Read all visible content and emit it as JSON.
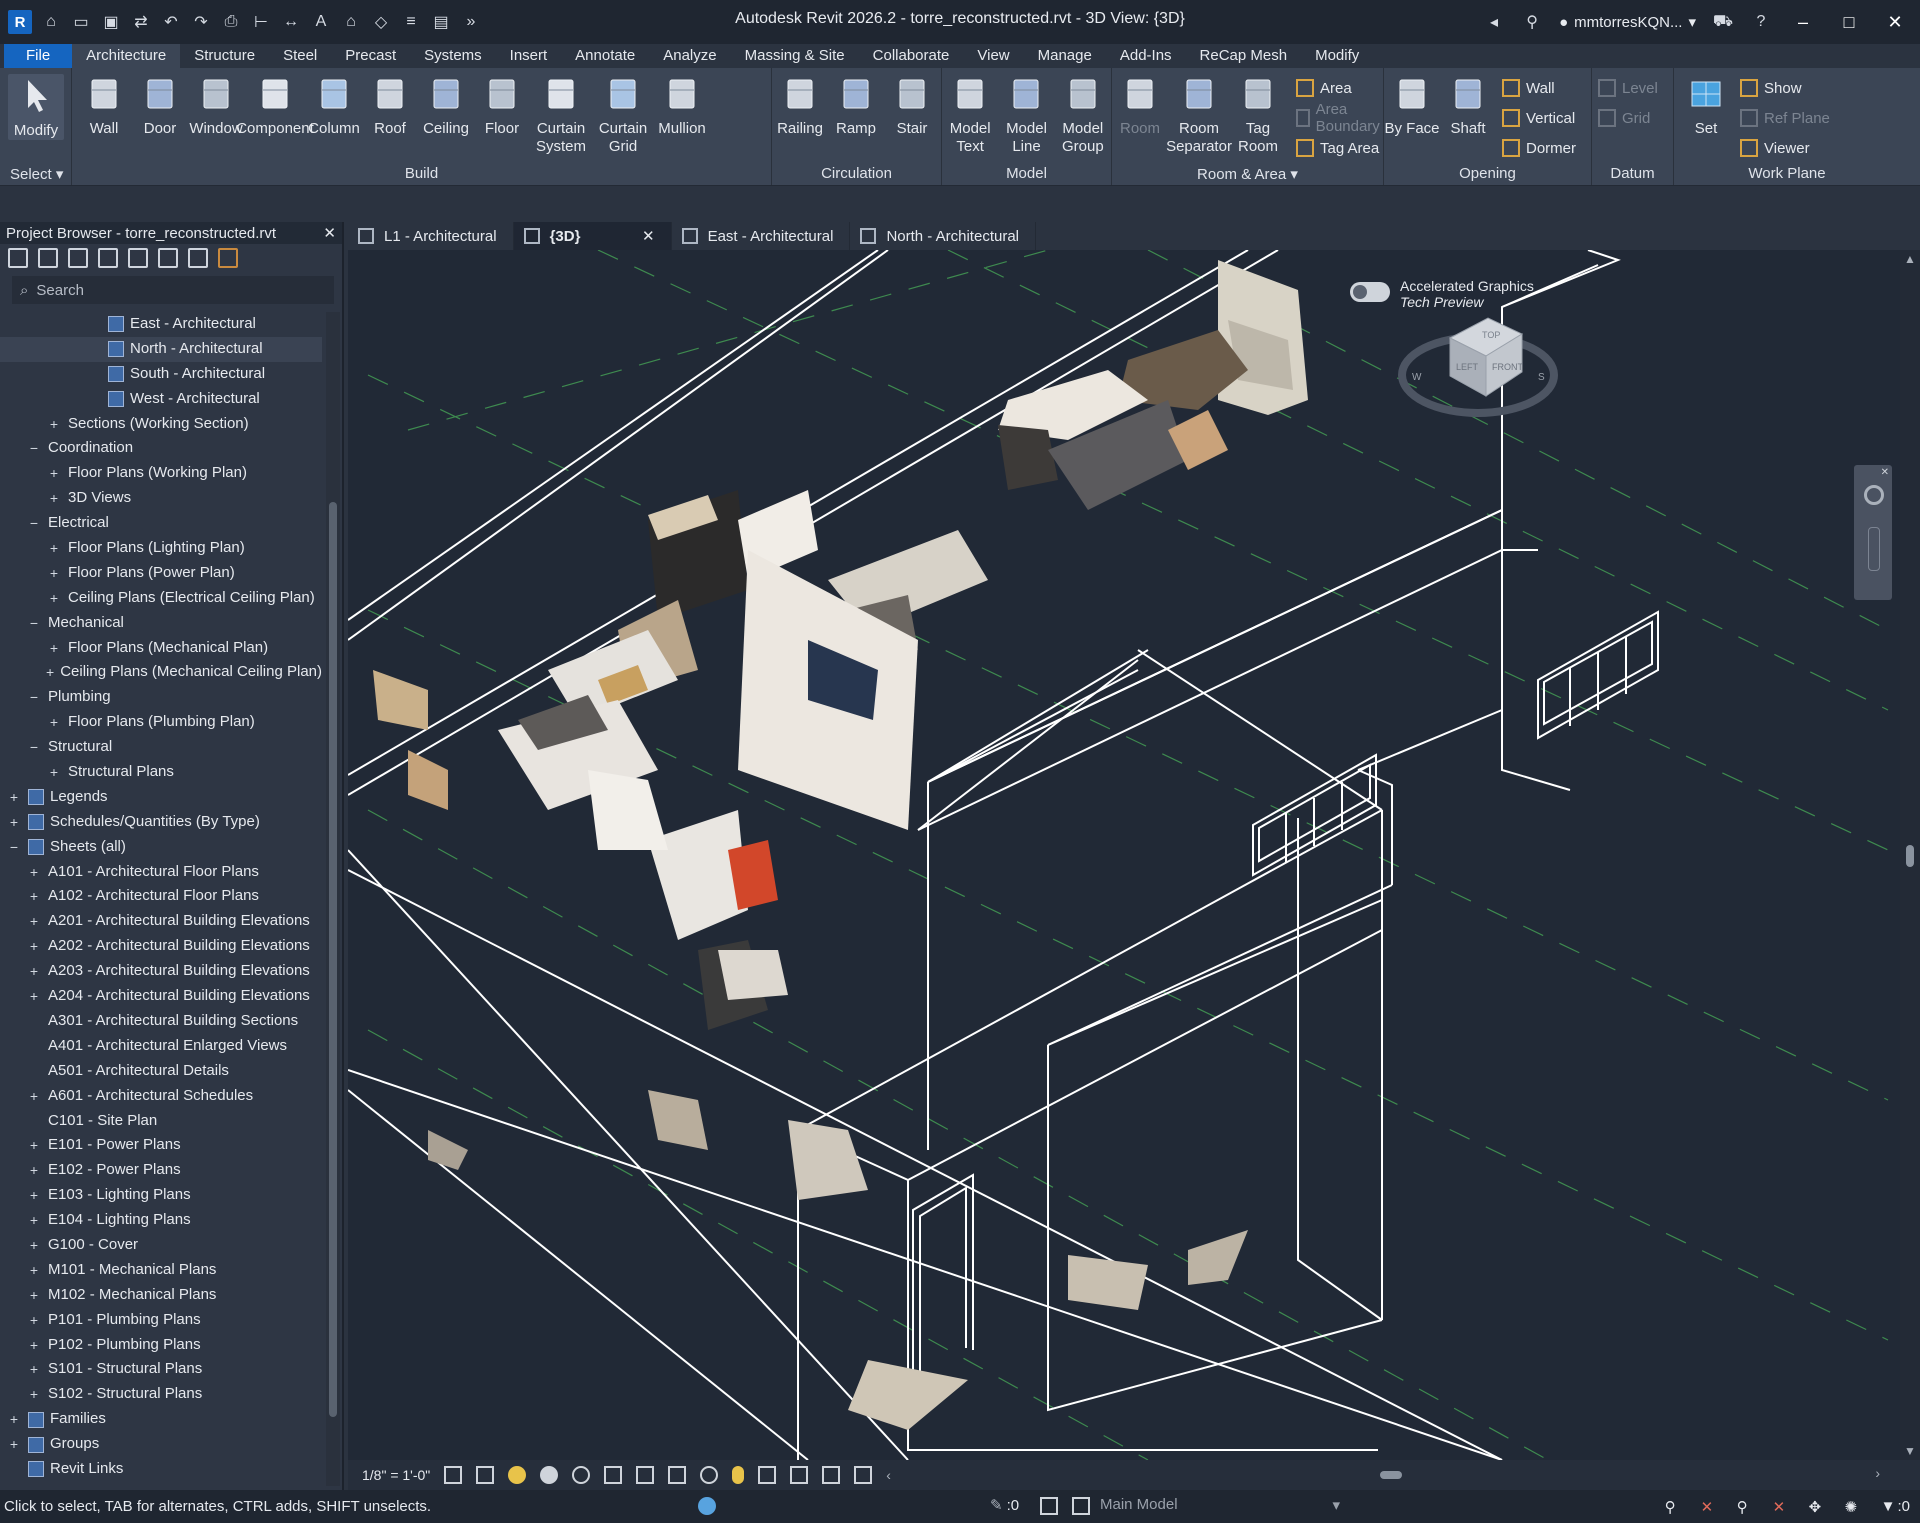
{
  "window": {
    "title": "Autodesk Revit 2026.2 - torre_reconstructed.rvt - 3D View: {3D}",
    "user": "mmtorresKQN...",
    "app_icon": "R"
  },
  "menu": {
    "tabs": [
      "File",
      "Architecture",
      "Structure",
      "Steel",
      "Precast",
      "Systems",
      "Insert",
      "Annotate",
      "Analyze",
      "Massing & Site",
      "Collaborate",
      "View",
      "Manage",
      "Add-Ins",
      "ReCap Mesh",
      "Modify"
    ],
    "active": "Architecture"
  },
  "ribbon": {
    "select": {
      "modify": "Modify",
      "label": "Select"
    },
    "build": {
      "label": "Build",
      "tools": [
        "Wall",
        "Door",
        "Window",
        "Component",
        "Column",
        "Roof",
        "Ceiling",
        "Floor",
        "Curtain System",
        "Curtain Grid",
        "Mullion"
      ]
    },
    "circulation": {
      "label": "Circulation",
      "tools": [
        "Railing",
        "Ramp",
        "Stair"
      ]
    },
    "model": {
      "label": "Model",
      "tools": [
        "Model Text",
        "Model Line",
        "Model Group"
      ]
    },
    "room_area": {
      "label": "Room & Area",
      "tools": [
        "Room",
        "Room Separator",
        "Tag Room"
      ],
      "small": [
        "Area",
        "Area Boundary",
        "Tag Area"
      ]
    },
    "opening": {
      "label": "Opening",
      "tools": [
        "By Face",
        "Shaft"
      ],
      "small": [
        "Wall",
        "Vertical",
        "Dormer"
      ]
    },
    "datum": {
      "label": "Datum",
      "small": [
        "Level",
        "Grid"
      ]
    },
    "work_plane": {
      "label": "Work Plane",
      "set": "Set",
      "small": [
        "Show",
        "Ref Plane",
        "Viewer"
      ]
    }
  },
  "browser": {
    "title": "Project Browser - torre_reconstructed.rvt",
    "search_placeholder": "Search",
    "nodes": [
      {
        "label": "East - Architectural",
        "indent": 4,
        "toggle": "",
        "icon": true
      },
      {
        "label": "North - Architectural",
        "indent": 4,
        "toggle": "",
        "icon": true,
        "selected": true
      },
      {
        "label": "South - Architectural",
        "indent": 4,
        "toggle": "",
        "icon": true
      },
      {
        "label": "West - Architectural",
        "indent": 4,
        "toggle": "",
        "icon": true
      },
      {
        "label": "Sections (Working Section)",
        "indent": 2,
        "toggle": "+"
      },
      {
        "label": "Coordination",
        "indent": 1,
        "toggle": "−"
      },
      {
        "label": "Floor Plans (Working Plan)",
        "indent": 2,
        "toggle": "+"
      },
      {
        "label": "3D Views",
        "indent": 2,
        "toggle": "+"
      },
      {
        "label": "Electrical",
        "indent": 1,
        "toggle": "−"
      },
      {
        "label": "Floor Plans (Lighting Plan)",
        "indent": 2,
        "toggle": "+"
      },
      {
        "label": "Floor Plans (Power Plan)",
        "indent": 2,
        "toggle": "+"
      },
      {
        "label": "Ceiling Plans (Electrical Ceiling Plan)",
        "indent": 2,
        "toggle": "+"
      },
      {
        "label": "Mechanical",
        "indent": 1,
        "toggle": "−"
      },
      {
        "label": "Floor Plans (Mechanical Plan)",
        "indent": 2,
        "toggle": "+"
      },
      {
        "label": "Ceiling Plans (Mechanical Ceiling Plan)",
        "indent": 2,
        "toggle": "+"
      },
      {
        "label": "Plumbing",
        "indent": 1,
        "toggle": "−"
      },
      {
        "label": "Floor Plans (Plumbing Plan)",
        "indent": 2,
        "toggle": "+"
      },
      {
        "label": "Structural",
        "indent": 1,
        "toggle": "−"
      },
      {
        "label": "Structural Plans",
        "indent": 2,
        "toggle": "+"
      },
      {
        "label": "Legends",
        "indent": 0,
        "toggle": "+",
        "icon": true
      },
      {
        "label": "Schedules/Quantities (By Type)",
        "indent": 0,
        "toggle": "+",
        "icon": true
      },
      {
        "label": "Sheets (all)",
        "indent": 0,
        "toggle": "−",
        "icon": true
      },
      {
        "label": "A101 - Architectural Floor Plans",
        "indent": 1,
        "toggle": "+"
      },
      {
        "label": "A102 - Architectural Floor Plans",
        "indent": 1,
        "toggle": "+"
      },
      {
        "label": "A201 - Architectural Building Elevations",
        "indent": 1,
        "toggle": "+"
      },
      {
        "label": "A202 - Architectural Building Elevations",
        "indent": 1,
        "toggle": "+"
      },
      {
        "label": "A203 - Architectural Building Elevations",
        "indent": 1,
        "toggle": "+"
      },
      {
        "label": "A204 - Architectural Building Elevations",
        "indent": 1,
        "toggle": "+"
      },
      {
        "label": "A301 - Architectural Building Sections",
        "indent": 1,
        "toggle": ""
      },
      {
        "label": "A401 - Architectural Enlarged Views",
        "indent": 1,
        "toggle": ""
      },
      {
        "label": "A501 - Architectural Details",
        "indent": 1,
        "toggle": ""
      },
      {
        "label": "A601 - Architectural Schedules",
        "indent": 1,
        "toggle": "+"
      },
      {
        "label": "C101 - Site Plan",
        "indent": 1,
        "toggle": ""
      },
      {
        "label": "E101 - Power Plans",
        "indent": 1,
        "toggle": "+"
      },
      {
        "label": "E102 - Power Plans",
        "indent": 1,
        "toggle": "+"
      },
      {
        "label": "E103 - Lighting Plans",
        "indent": 1,
        "toggle": "+"
      },
      {
        "label": "E104 - Lighting Plans",
        "indent": 1,
        "toggle": "+"
      },
      {
        "label": "G100 - Cover",
        "indent": 1,
        "toggle": "+"
      },
      {
        "label": "M101 - Mechanical Plans",
        "indent": 1,
        "toggle": "+"
      },
      {
        "label": "M102 - Mechanical Plans",
        "indent": 1,
        "toggle": "+"
      },
      {
        "label": "P101 - Plumbing Plans",
        "indent": 1,
        "toggle": "+"
      },
      {
        "label": "P102 - Plumbing Plans",
        "indent": 1,
        "toggle": "+"
      },
      {
        "label": "S101 - Structural Plans",
        "indent": 1,
        "toggle": "+"
      },
      {
        "label": "S102 - Structural Plans",
        "indent": 1,
        "toggle": "+"
      },
      {
        "label": "Families",
        "indent": 0,
        "toggle": "+",
        "icon": true
      },
      {
        "label": "Groups",
        "indent": 0,
        "toggle": "+",
        "icon": true
      },
      {
        "label": "Revit Links",
        "indent": 0,
        "toggle": "",
        "icon": true
      }
    ]
  },
  "view_tabs": [
    {
      "label": "L1 - Architectural",
      "active": false,
      "closable": false
    },
    {
      "label": "{3D}",
      "active": true,
      "closable": true
    },
    {
      "label": "East - Architectural",
      "active": false,
      "closable": false
    },
    {
      "label": "North - Architectural",
      "active": false,
      "closable": false
    }
  ],
  "canvas": {
    "graphics_toggle_line1": "Accelerated Graphics",
    "graphics_toggle_line2": "Tech Preview",
    "viewcube": {
      "top": "TOP",
      "left": "LEFT",
      "front": "FRONT",
      "compass_s": "S",
      "compass_w": "W"
    }
  },
  "view_bar": {
    "scale": "1/8\" = 1'-0\""
  },
  "status": {
    "message": "Click to select, TAB for alternates, CTRL adds, SHIFT unselects.",
    "workset_count": ":0",
    "model": "Main Model",
    "filter_count": ":0"
  },
  "colors": {
    "file_tab": "#1565c0",
    "canvas_bg": "#212936",
    "ribbon_bg": "#3b4555",
    "model_lines": "#ffffff"
  }
}
